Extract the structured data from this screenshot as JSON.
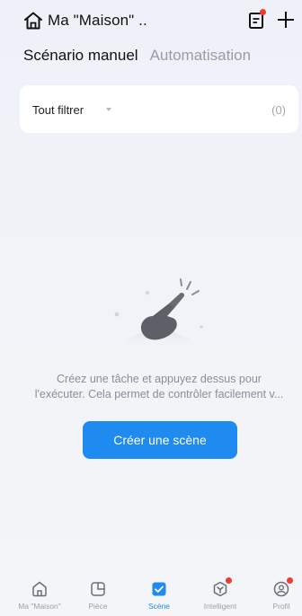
{
  "header": {
    "title": "Ma \"Maison\" ..",
    "home_icon": "home-icon",
    "notes_icon": "notes-icon",
    "add_icon": "plus-icon",
    "notification_color": "#f23a2e"
  },
  "tabs": [
    {
      "label": "Scénario manuel",
      "active": true
    },
    {
      "label": "Automatisation",
      "active": false
    }
  ],
  "filter": {
    "label": "Tout filtrer",
    "count": "(0)"
  },
  "empty_state": {
    "line1": "Créez une tâche et appuyez dessus pour",
    "line2": "l'exécuter. Cela permet de contrôler facilement v...",
    "illustration": "tap-hand-illustration"
  },
  "create_button": {
    "label": "Créer une scène",
    "color": "#1f8bf0"
  },
  "bottom_nav": [
    {
      "label": "Ma \"Maison\"",
      "icon": "home-icon",
      "active": false,
      "badge": false
    },
    {
      "label": "Pièce",
      "icon": "room-icon",
      "active": false,
      "badge": false
    },
    {
      "label": "Scène",
      "icon": "scene-check-icon",
      "active": true,
      "badge": false
    },
    {
      "label": "Intelligent",
      "icon": "intelligent-icon",
      "active": false,
      "badge": true
    },
    {
      "label": "Profil",
      "icon": "profile-icon",
      "active": false,
      "badge": true
    }
  ]
}
